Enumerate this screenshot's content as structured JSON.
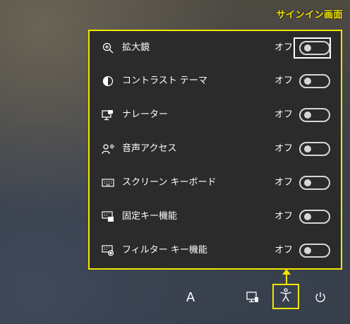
{
  "caption": "サインイン画面",
  "panel": {
    "items": [
      {
        "label": "拡大鏡",
        "state": "オフ",
        "icon": "magnifier-icon"
      },
      {
        "label": "コントラスト テーマ",
        "state": "オフ",
        "icon": "contrast-icon"
      },
      {
        "label": "ナレーター",
        "state": "オフ",
        "icon": "narrator-icon"
      },
      {
        "label": "音声アクセス",
        "state": "オフ",
        "icon": "voice-access-icon"
      },
      {
        "label": "スクリーン キーボード",
        "state": "オフ",
        "icon": "keyboard-icon"
      },
      {
        "label": "固定キー機能",
        "state": "オフ",
        "icon": "sticky-keys-icon"
      },
      {
        "label": "フィルター キー機能",
        "state": "オフ",
        "icon": "filter-keys-icon"
      }
    ]
  },
  "taskbar": {
    "language": "A",
    "icons": [
      "network-icon",
      "accessibility-icon",
      "power-icon"
    ]
  },
  "colors": {
    "highlight": "#f2e600",
    "panel_bg": "#2b2b2b",
    "text": "#ffffff"
  }
}
